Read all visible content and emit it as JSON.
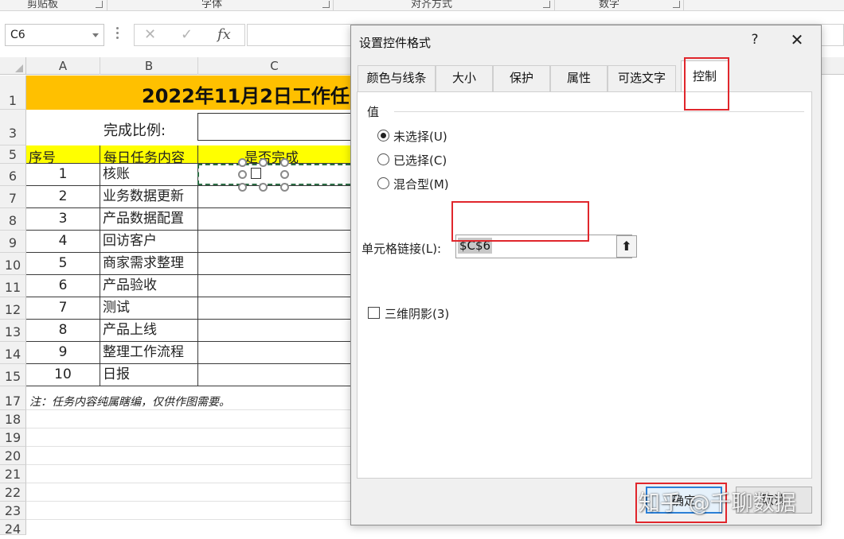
{
  "ribbon": {
    "groups": [
      "剪贴板",
      "字体",
      "对齐方式",
      "数字"
    ]
  },
  "formula_bar": {
    "name_box": "C6",
    "cancel_icon": "✕",
    "enter_icon": "✓",
    "fx_label": "fx",
    "formula": ""
  },
  "sheet": {
    "columns": [
      "A",
      "B",
      "C"
    ],
    "rows": [
      "1",
      "3",
      "5",
      "6",
      "7",
      "8",
      "9",
      "10",
      "11",
      "12",
      "13",
      "14",
      "15",
      "17",
      "18",
      "19",
      "20",
      "21",
      "22",
      "23",
      "24"
    ],
    "title": "2022年11月2日工作任",
    "ratio_label": "完成比例:",
    "headers": {
      "seq": "序号",
      "task": "每日任务内容",
      "done": "是否完成"
    },
    "tasks": [
      {
        "seq": "1",
        "task": "核账"
      },
      {
        "seq": "2",
        "task": "业务数据更新"
      },
      {
        "seq": "3",
        "task": "产品数据配置"
      },
      {
        "seq": "4",
        "task": "回访客户"
      },
      {
        "seq": "5",
        "task": "商家需求整理"
      },
      {
        "seq": "6",
        "task": "产品验收"
      },
      {
        "seq": "7",
        "task": "测试"
      },
      {
        "seq": "8",
        "task": "产品上线"
      },
      {
        "seq": "9",
        "task": "整理工作流程"
      },
      {
        "seq": "10",
        "task": "日报"
      }
    ],
    "note": "注：任务内容纯属瞎编，仅供作图需要。"
  },
  "dialog": {
    "title": "设置控件格式",
    "help": "?",
    "close": "✕",
    "tabs": [
      "颜色与线条",
      "大小",
      "保护",
      "属性",
      "可选文字",
      "控制"
    ],
    "active_tab": "控制",
    "value_group_label": "值",
    "radio_options": [
      {
        "label": "未选择(U)",
        "selected": true
      },
      {
        "label": "已选择(C)",
        "selected": false
      },
      {
        "label": "混合型(M)",
        "selected": false
      }
    ],
    "cell_link_label": "单元格链接(L):",
    "cell_link_value": "$C$6",
    "collapse_icon": "⬆",
    "shading_label": "三维阴影(3)",
    "shading_checked": false,
    "ok_label": "确定",
    "cancel_label": "取消"
  },
  "watermark": "知乎 @千聊数据",
  "colors": {
    "title_fill": "#ffc000",
    "header_fill": "#ffff00",
    "highlight": "#e0262c",
    "selection_dash": "#2e6e46"
  }
}
